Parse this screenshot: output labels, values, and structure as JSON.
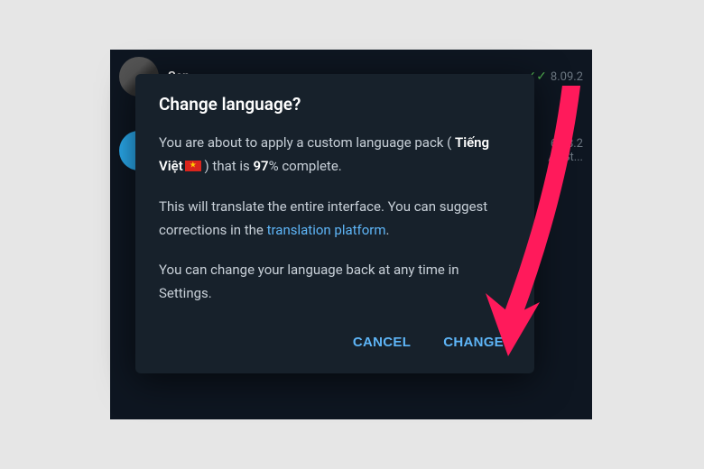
{
  "chats": [
    {
      "name": "Sen",
      "date": "8.09.2"
    },
    {
      "name": "",
      "date": "6.08.2",
      "sub": "/o-St..."
    }
  ],
  "dialog": {
    "title": "Change language?",
    "body": {
      "p1_a": "You are about to apply a custom language pack ( ",
      "lang_name": "Tiếng Việt",
      "p1_b": " ) that is ",
      "percent": "97",
      "p1_c": "% complete.",
      "p2_a": "This will translate the entire interface. You can suggest corrections in the ",
      "link": "translation platform",
      "p2_b": ".",
      "p3": "You can change your language back at any time in Settings."
    },
    "cancel": "CANCEL",
    "change": "CHANGE"
  }
}
